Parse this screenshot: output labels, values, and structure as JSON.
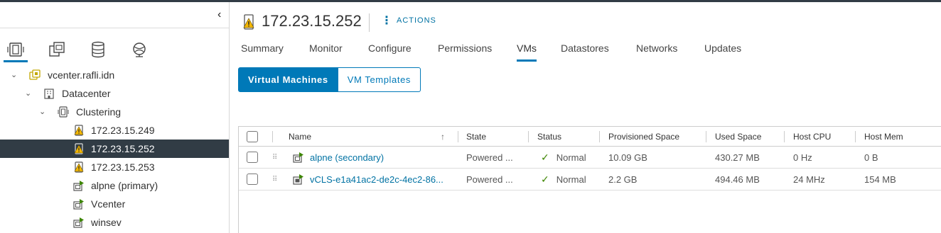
{
  "navigator": {
    "collapse_glyph": "‹",
    "tabs": [
      {
        "icon": "hosts-clusters-icon",
        "active": true
      },
      {
        "icon": "vms-templates-icon",
        "active": false
      },
      {
        "icon": "storage-icon",
        "active": false
      },
      {
        "icon": "networking-icon",
        "active": false
      }
    ],
    "tree": [
      {
        "label": "vcenter.rafli.idn",
        "icon": "vcenter-icon",
        "caret": "⌄",
        "level": 0
      },
      {
        "label": "Datacenter",
        "icon": "datacenter-icon",
        "caret": "⌄",
        "level": 1
      },
      {
        "label": "Clustering",
        "icon": "cluster-icon",
        "caret": "⌄",
        "level": 2
      },
      {
        "label": "172.23.15.249",
        "icon": "host-warning-icon",
        "level": 3
      },
      {
        "label": "172.23.15.252",
        "icon": "host-warning-icon",
        "level": 3,
        "selected": true
      },
      {
        "label": "172.23.15.253",
        "icon": "host-warning-icon",
        "level": 3
      },
      {
        "label": "alpne (primary)",
        "icon": "vm-powered-on-icon",
        "level": 3
      },
      {
        "label": "Vcenter",
        "icon": "vm-powered-on-icon",
        "level": 3
      },
      {
        "label": "winsev",
        "icon": "vm-powered-on-icon",
        "level": 3
      }
    ]
  },
  "header": {
    "title": "172.23.15.252",
    "actions_label": "ACTIONS",
    "actions_glyph": "⋮"
  },
  "tabs": [
    "Summary",
    "Monitor",
    "Configure",
    "Permissions",
    "VMs",
    "Datastores",
    "Networks",
    "Updates"
  ],
  "active_tab": "VMs",
  "subtabs": [
    "Virtual Machines",
    "VM Templates"
  ],
  "active_subtab": "Virtual Machines",
  "grid": {
    "columns": [
      "Name",
      "State",
      "Status",
      "Provisioned Space",
      "Used Space",
      "Host CPU",
      "Host Mem"
    ],
    "sort_glyph": "↑",
    "rows": [
      {
        "name": "alpne (secondary)",
        "state": "Powered ...",
        "status": "Normal",
        "provisioned": "10.09 GB",
        "used": "430.27 MB",
        "cpu": "0 Hz",
        "mem": "0 B"
      },
      {
        "name": "vCLS-e1a41ac2-de2c-4ec2-86...",
        "state": "Powered ...",
        "status": "Normal",
        "provisioned": "2.2 GB",
        "used": "494.46 MB",
        "cpu": "24 MHz",
        "mem": "154 MB"
      }
    ],
    "status_glyph": "✓",
    "drag_glyph": "⠿"
  },
  "colors": {
    "accent": "#0079b8",
    "link": "#0072a3",
    "selected_bg": "#313c45",
    "ok": "#3c8500",
    "warning": "#f5b800",
    "vm_green": "#3c8500"
  }
}
